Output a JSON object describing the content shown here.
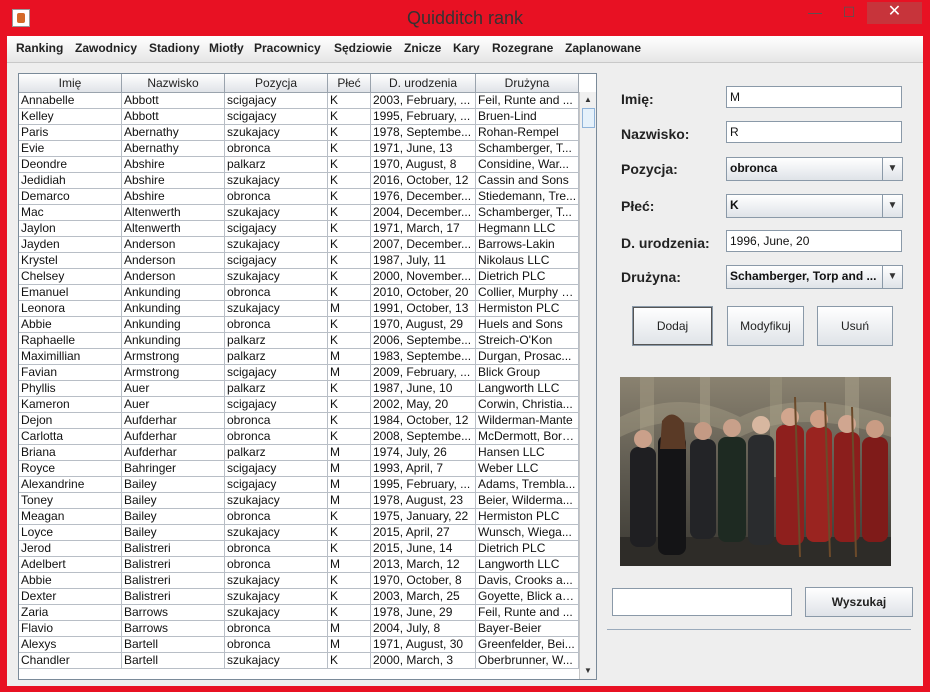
{
  "window": {
    "title": "Quidditch rank",
    "min_glyph": "—",
    "max_glyph": "☐",
    "close_glyph": "✕"
  },
  "menu": [
    "Ranking",
    "Zawodnicy",
    "Stadiony",
    "Miotły",
    "Pracownicy",
    "Sędziowie",
    "Znicze",
    "Kary",
    "Rozegrane",
    "Zaplanowane"
  ],
  "table": {
    "columns": [
      "Imię",
      "Nazwisko",
      "Pozycja",
      "Płeć",
      "D. urodzenia",
      "Drużyna"
    ],
    "rows": [
      [
        "Annabelle",
        "Abbott",
        "scigajacy",
        "K",
        "2003, February, ...",
        "Feil, Runte and ..."
      ],
      [
        "Kelley",
        "Abbott",
        "scigajacy",
        "K",
        "1995, February, ...",
        "Bruen-Lind"
      ],
      [
        "Paris",
        "Abernathy",
        "szukajacy",
        "K",
        "1978, Septembe...",
        "Rohan-Rempel"
      ],
      [
        "Evie",
        "Abernathy",
        "obronca",
        "K",
        "1971, June, 13",
        "Schamberger, T..."
      ],
      [
        "Deondre",
        "Abshire",
        "palkarz",
        "K",
        "1970, August, 8",
        "Considine, War..."
      ],
      [
        "Jedidiah",
        "Abshire",
        "szukajacy",
        "K",
        "2016, October, 12",
        "Cassin and Sons"
      ],
      [
        "Demarco",
        "Abshire",
        "obronca",
        "K",
        "1976, December...",
        "Stiedemann, Tre..."
      ],
      [
        "Mac",
        "Altenwerth",
        "szukajacy",
        "K",
        "2004, December...",
        "Schamberger, T..."
      ],
      [
        "Jaylon",
        "Altenwerth",
        "scigajacy",
        "K",
        "1971, March, 17",
        "Hegmann LLC"
      ],
      [
        "Jayden",
        "Anderson",
        "szukajacy",
        "K",
        "2007, December...",
        "Barrows-Lakin"
      ],
      [
        "Krystel",
        "Anderson",
        "scigajacy",
        "K",
        "1987, July, 11",
        "Nikolaus LLC"
      ],
      [
        "Chelsey",
        "Anderson",
        "szukajacy",
        "K",
        "2000, November...",
        "Dietrich PLC"
      ],
      [
        "Emanuel",
        "Ankunding",
        "obronca",
        "K",
        "2010, October, 20",
        "Collier, Murphy a..."
      ],
      [
        "Leonora",
        "Ankunding",
        "szukajacy",
        "M",
        "1991, October, 13",
        "Hermiston PLC"
      ],
      [
        "Abbie",
        "Ankunding",
        "obronca",
        "K",
        "1970, August, 29",
        "Huels and Sons"
      ],
      [
        "Raphaelle",
        "Ankunding",
        "palkarz",
        "K",
        "2006, Septembe...",
        "Streich-O'Kon"
      ],
      [
        "Maximillian",
        "Armstrong",
        "palkarz",
        "M",
        "1983, Septembe...",
        "Durgan, Prosac..."
      ],
      [
        "Favian",
        "Armstrong",
        "scigajacy",
        "M",
        "2009, February, ...",
        "Blick Group"
      ],
      [
        "Phyllis",
        "Auer",
        "palkarz",
        "K",
        "1987, June, 10",
        "Langworth LLC"
      ],
      [
        "Kameron",
        "Auer",
        "scigajacy",
        "K",
        "2002, May, 20",
        "Corwin, Christia..."
      ],
      [
        "Dejon",
        "Aufderhar",
        "obronca",
        "K",
        "1984, October, 12",
        "Wilderman-Mante"
      ],
      [
        "Carlotta",
        "Aufderhar",
        "obronca",
        "K",
        "2008, Septembe...",
        "McDermott, Bore..."
      ],
      [
        "Briana",
        "Aufderhar",
        "palkarz",
        "M",
        "1974, July, 26",
        "Hansen LLC"
      ],
      [
        "Royce",
        "Bahringer",
        "scigajacy",
        "M",
        "1993, April, 7",
        "Weber LLC"
      ],
      [
        "Alexandrine",
        "Bailey",
        "scigajacy",
        "M",
        "1995, February, ...",
        "Adams, Trembla..."
      ],
      [
        "Toney",
        "Bailey",
        "szukajacy",
        "M",
        "1978, August, 23",
        "Beier, Wilderma..."
      ],
      [
        "Meagan",
        "Bailey",
        "obronca",
        "K",
        "1975, January, 22",
        "Hermiston PLC"
      ],
      [
        "Loyce",
        "Bailey",
        "szukajacy",
        "K",
        "2015, April, 27",
        "Wunsch, Wiega..."
      ],
      [
        "Jerod",
        "Balistreri",
        "obronca",
        "K",
        "2015, June, 14",
        "Dietrich PLC"
      ],
      [
        "Adelbert",
        "Balistreri",
        "obronca",
        "M",
        "2013, March, 12",
        "Langworth LLC"
      ],
      [
        "Abbie",
        "Balistreri",
        "szukajacy",
        "K",
        "1970, October, 8",
        "Davis, Crooks a..."
      ],
      [
        "Dexter",
        "Balistreri",
        "szukajacy",
        "K",
        "2003, March, 25",
        "Goyette, Blick an..."
      ],
      [
        "Zaria",
        "Barrows",
        "szukajacy",
        "K",
        "1978, June, 29",
        "Feil, Runte and ..."
      ],
      [
        "Flavio",
        "Barrows",
        "obronca",
        "M",
        "2004, July, 8",
        "Bayer-Beier"
      ],
      [
        "Alexys",
        "Bartell",
        "obronca",
        "M",
        "1971, August, 30",
        "Greenfelder, Bei..."
      ],
      [
        "Chandler",
        "Bartell",
        "szukajacy",
        "K",
        "2000, March, 3",
        "Oberbrunner, W..."
      ]
    ]
  },
  "form": {
    "imie_label": "Imię:",
    "imie_value": "M",
    "nazwisko_label": "Nazwisko:",
    "nazwisko_value": "R",
    "pozycja_label": "Pozycja:",
    "pozycja_value": "obronca",
    "plec_label": "Płeć:",
    "plec_value": "K",
    "urodzenia_label": "D. urodzenia:",
    "urodzenia_value": "1996, June, 20",
    "druzyna_label": "Drużyna:",
    "druzyna_value": "Schamberger, Torp and ..."
  },
  "buttons": {
    "add": "Dodaj",
    "modify": "Modyfikuj",
    "delete": "Usuń"
  },
  "search": {
    "value": "",
    "button": "Wyszukaj"
  }
}
